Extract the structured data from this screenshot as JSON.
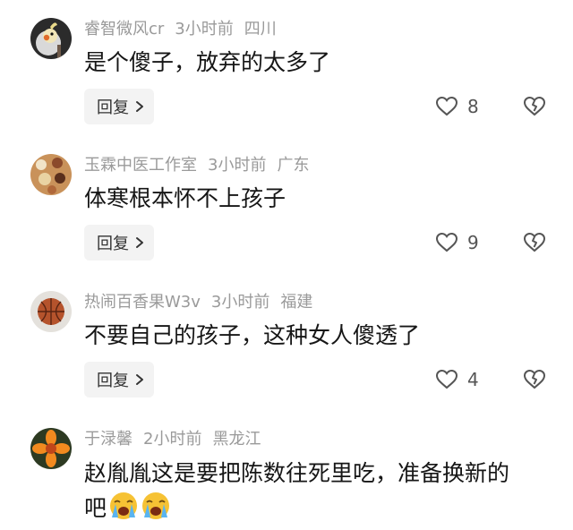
{
  "comments": [
    {
      "author": "睿智微风cr",
      "time": "3小时前",
      "location": "四川",
      "text": "是个傻子，放弃的太多了",
      "reply_label": "回复",
      "likes": "8",
      "avatar_icon": "cockatiel-bird-avatar"
    },
    {
      "author": "玉霖中医工作室",
      "time": "3小时前",
      "location": "广东",
      "text": "体寒根本怀不上孩子",
      "reply_label": "回复",
      "likes": "9",
      "avatar_icon": "herbs-tray-avatar"
    },
    {
      "author": "热闹百香果W3v",
      "time": "3小时前",
      "location": "福建",
      "text": "不要自己的孩子，这种女人傻透了",
      "reply_label": "回复",
      "likes": "4",
      "avatar_icon": "basketball-avatar"
    },
    {
      "author": "于渌馨",
      "time": "2小时前",
      "location": "黑龙江",
      "text_line1": "赵胤胤这是要把陈数往死里吃，准备换新的",
      "text_line2": "吧",
      "emoji_icon": "loudly-crying-face-icon",
      "avatar_icon": "flower-avatar"
    }
  ],
  "colors": {
    "meta_gray": "#9a9a9a",
    "text": "#161616",
    "reply_bg": "#f3f3f3"
  }
}
